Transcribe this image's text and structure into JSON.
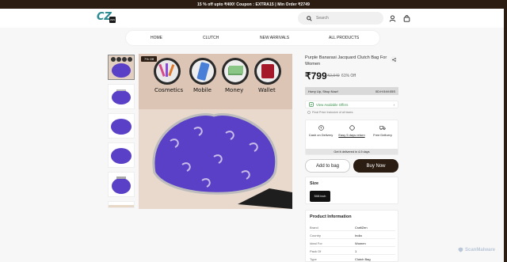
{
  "promo": {
    "text": "15 % off upto ₹400! Coupon : EXTRA15 | Min Order ₹2749"
  },
  "header": {
    "logo_text": "CZ",
    "logo_sub": "ZEN",
    "search_placeholder": "Search",
    "user_icon": "user-icon",
    "cart_icon": "shopping-bag-icon"
  },
  "nav": {
    "items": [
      "HOME",
      "CLUTCH",
      "NEW ARRIVALS",
      "ALL PRODUCTS"
    ]
  },
  "gallery": {
    "badge": "7% Off",
    "overlay_labels": [
      "Cosmetics",
      "Mobile",
      "Money",
      "Wallet"
    ],
    "more_icon": "chevron-down-icon",
    "colors": {
      "purple": "#5a3fc7",
      "background": "#dcc5b4"
    }
  },
  "product": {
    "title": "Purple Banarasi Jacquard Clutch Bag For Women",
    "price": "₹799",
    "mrp": "₹2,949",
    "discount": "61% Off",
    "hurry_text": "Hurry Up, Shop Now!",
    "timer": "0D:H:5:M:05S",
    "offers_label": "View Available Offers",
    "final_price_note": "Final Price Inclusive of all taxes",
    "features": [
      {
        "label": "Cash on Delivery",
        "icon": "rupee-icon"
      },
      {
        "label": "Easy 5 days return",
        "icon": "return-icon"
      },
      {
        "label": "Free Delivery",
        "icon": "truck-icon"
      }
    ],
    "delivery_note": "Get it delivered in 4-9 days",
    "add_to_bag": "Add to bag",
    "buy_now": "Buy Now",
    "size_label": "Size",
    "size_option": "5X8 inch"
  },
  "info": {
    "heading": "Product Information",
    "rows": [
      {
        "k": "Brand",
        "v": "CraftZen"
      },
      {
        "k": "Country",
        "v": "India"
      },
      {
        "k": "Ideal For",
        "v": "Women"
      },
      {
        "k": "Pack Of",
        "v": "1"
      },
      {
        "k": "Type",
        "v": "Clutch Bag"
      }
    ]
  },
  "watermark": {
    "text": "ScanMalware"
  },
  "brand_colors": {
    "dark": "#2b1d12",
    "accent": "#2a8a92",
    "offer_green": "#3a8f4c"
  }
}
